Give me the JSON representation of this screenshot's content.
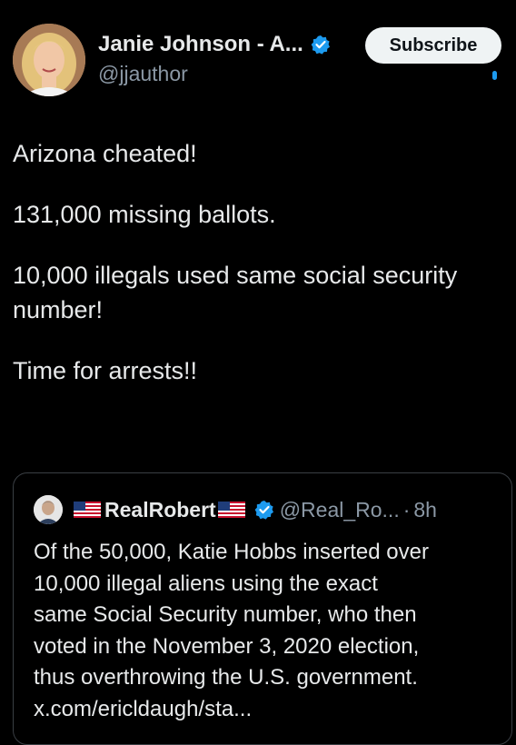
{
  "author": {
    "display_name": "Janie Johnson - A...",
    "handle": "@jjauthor",
    "avatar_icon": "woman-portrait-avatar",
    "verified_icon": "verified-badge-icon",
    "verified_color": "#1d9bf0"
  },
  "subscribe_button": {
    "label": "Subscribe"
  },
  "tweet": {
    "paragraphs": [
      "Arizona cheated!",
      "131,000 missing ballots.",
      "10,000 illegals used same social security number!",
      "Time for arrests!!"
    ]
  },
  "quote": {
    "avatar_icon": "man-portrait-avatar",
    "flag_icon": "us-flag-icon",
    "display_name": "RealRobert",
    "handle": "@Real_Ro...",
    "separator": "·",
    "time": "8h",
    "text": "Of the 50,000, Katie Hobbs inserted over\n10,000 illegal aliens using the exact\nsame Social Security number, who then\nvoted in the November 3, 2020 election,\nthus overthrowing the U.S. government.\nx.com/ericldaugh/sta..."
  },
  "colors": {
    "background": "#000000",
    "primary_text": "#e7e9ea",
    "secondary_text": "#8b98a5",
    "accent": "#1d9bf0",
    "button_bg": "#eff3f4",
    "border": "#3a3f44"
  }
}
